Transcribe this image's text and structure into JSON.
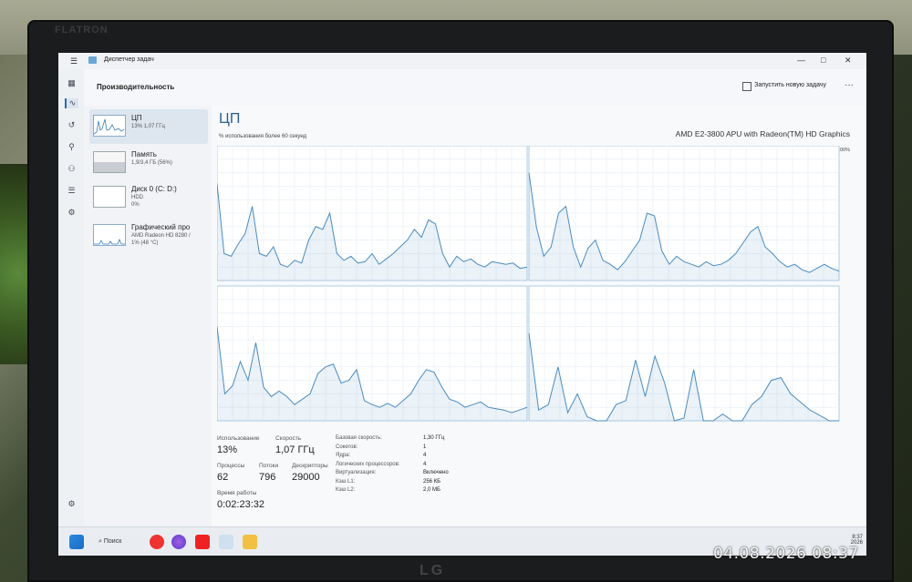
{
  "monitor_brand": "FLATRON",
  "monitor_logo": "LG",
  "window": {
    "title": "Диспетчер задач",
    "min": "—",
    "max": "□",
    "close": "✕"
  },
  "header": {
    "title": "Производительность",
    "run_task": "Запустить новую задачу",
    "more": "···"
  },
  "rail": [
    "menu-icon",
    "processes-icon",
    "performance-icon",
    "history-icon",
    "startup-icon",
    "users-icon",
    "details-icon",
    "services-icon",
    "settings-icon"
  ],
  "sidebar": {
    "items": [
      {
        "name": "ЦП",
        "sub": "13% 1,07 ГГц"
      },
      {
        "name": "Память",
        "sub": "1,9/3,4 ГБ (56%)"
      },
      {
        "name": "Диск 0 (C: D:)",
        "sub": "HDD",
        "sub2": "0%"
      },
      {
        "name": "Графический про",
        "sub": "AMD Radeon HD 8280 /",
        "sub2": "1% (48 °C)"
      }
    ]
  },
  "cpu": {
    "title": "ЦП",
    "model": "AMD E2-3800 APU with Radeon(TM) HD Graphics",
    "graph_label": "% использования более 60 секунд",
    "max_label": "100%"
  },
  "stats": {
    "usage_label": "Использование",
    "usage": "13%",
    "speed_label": "Скорость",
    "speed": "1,07 ГГц",
    "proc_label": "Процессы",
    "proc": "62",
    "threads_label": "Потоки",
    "threads": "796",
    "handles_label": "Дескрипторы",
    "handles": "29000",
    "uptime_label": "Время работы",
    "uptime": "0:02:23:32"
  },
  "specs": [
    {
      "k": "Базовая скорость:",
      "v": "1,30 ГГц"
    },
    {
      "k": "Сокетов:",
      "v": "1"
    },
    {
      "k": "Ядра:",
      "v": "4"
    },
    {
      "k": "Логических процессоров:",
      "v": "4"
    },
    {
      "k": "Виртуализация:",
      "v": "Включено"
    },
    {
      "k": "Кэш L1:",
      "v": "256 КБ"
    },
    {
      "k": "Кэш L2:",
      "v": "2,0 МБ"
    }
  ],
  "taskbar": {
    "search": "Поиск",
    "time": "8:37",
    "date": "2026"
  },
  "photo_timestamp": "04.08.2026 08:37",
  "chart_data": {
    "type": "line",
    "ylim": [
      0,
      100
    ],
    "series": [
      {
        "values": [
          72,
          20,
          18,
          27,
          35,
          55,
          20,
          18,
          25,
          12,
          10,
          15,
          13,
          30,
          40,
          38,
          50,
          20,
          15,
          18,
          13,
          14,
          20,
          12,
          16,
          20,
          25,
          30,
          38,
          32,
          45,
          42,
          20,
          10,
          18,
          14,
          16,
          12,
          10,
          14,
          13,
          12,
          13,
          9,
          10
        ]
      },
      {
        "values": [
          80,
          40,
          18,
          25,
          50,
          55,
          25,
          10,
          24,
          30,
          15,
          12,
          8,
          14,
          22,
          30,
          50,
          48,
          22,
          12,
          18,
          14,
          12,
          10,
          14,
          11,
          12,
          15,
          20,
          28,
          36,
          40,
          25,
          20,
          14,
          10,
          12,
          8,
          6,
          9,
          12,
          9,
          7
        ]
      },
      {
        "values": [
          70,
          20,
          26,
          44,
          30,
          58,
          25,
          18,
          22,
          18,
          12,
          16,
          20,
          35,
          40,
          42,
          28,
          30,
          38,
          15,
          12,
          10,
          13,
          10,
          15,
          20,
          30,
          38,
          36,
          25,
          16,
          14,
          10,
          12,
          14,
          10,
          9,
          8,
          6,
          8,
          10
        ]
      },
      {
        "values": [
          65,
          8,
          12,
          40,
          6,
          20,
          3,
          0,
          0,
          12,
          15,
          45,
          18,
          48,
          28,
          0,
          2,
          38,
          0,
          0,
          5,
          0,
          0,
          12,
          18,
          30,
          32,
          20,
          14,
          8,
          4,
          0,
          0
        ]
      }
    ]
  }
}
